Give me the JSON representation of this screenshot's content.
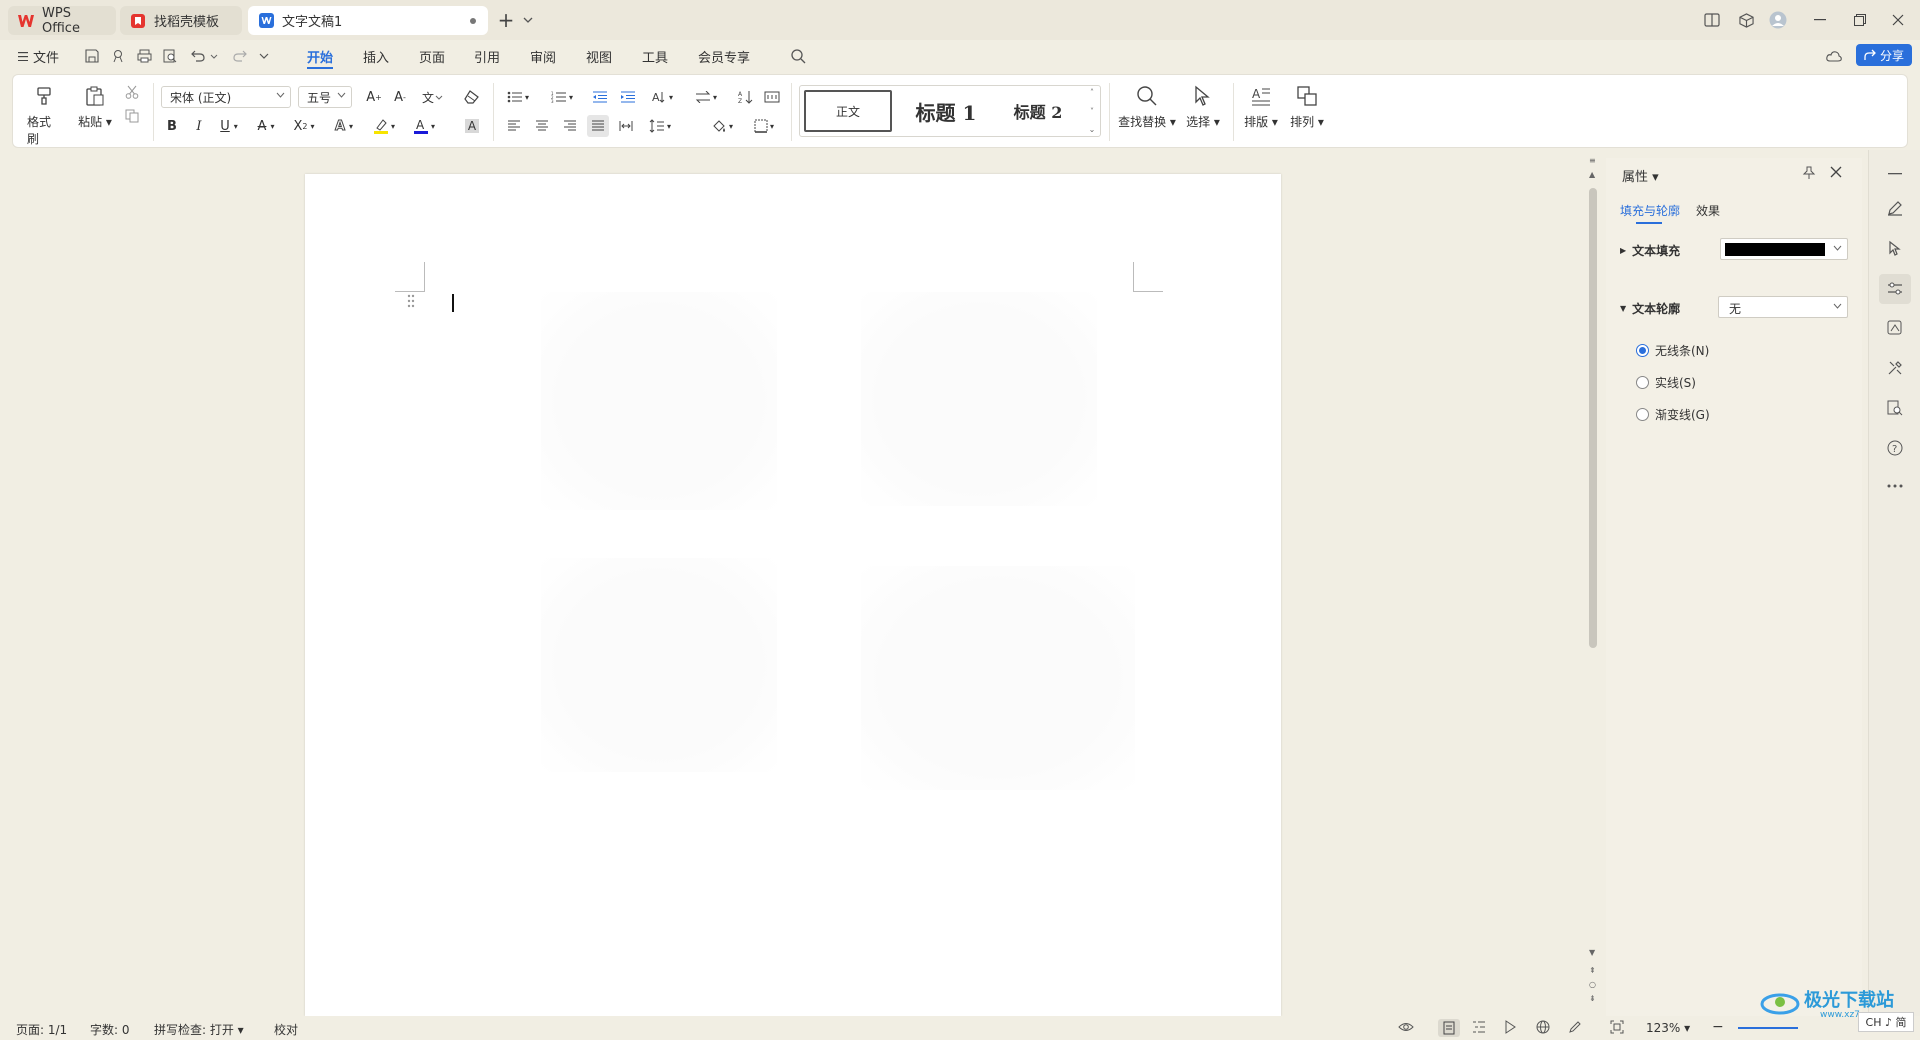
{
  "tabs": [
    {
      "label": "WPS Office"
    },
    {
      "label": "找稻壳模板"
    },
    {
      "label": "文字文稿1"
    }
  ],
  "menu": {
    "file_label": "文件",
    "tabs": [
      "开始",
      "插入",
      "页面",
      "引用",
      "审阅",
      "视图",
      "工具",
      "会员专享"
    ],
    "active_tab": "开始",
    "share_label": "分享"
  },
  "ribbon": {
    "format_painter": "格式刷",
    "paste": "粘贴",
    "font_name": "宋体 (正文)",
    "font_size": "五号",
    "styles": [
      "正文",
      "标题 1",
      "标题 2"
    ],
    "find_replace": "查找替换",
    "select": "选择",
    "layout": "排版",
    "arrange": "排列"
  },
  "panel": {
    "title": "属性",
    "tabs": [
      "填充与轮廓",
      "效果"
    ],
    "text_fill_label": "文本填充",
    "text_fill_color": "#000000",
    "text_outline_label": "文本轮廓",
    "text_outline_value": "无",
    "options": [
      "无线条(N)",
      "实线(S)",
      "渐变线(G)"
    ],
    "selected_option": 0
  },
  "status": {
    "page": "页面: 1/1",
    "word_count": "字数: 0",
    "spell_check": "拼写检查: 打开",
    "proofread": "校对",
    "zoom": "123%"
  },
  "watermark": {
    "site": "极光下载站",
    "url": "www.xz7.com",
    "ime": "CH ♪ 简"
  },
  "colors": {
    "accent": "#2a6fdb",
    "wps_red": "#e5352f"
  }
}
